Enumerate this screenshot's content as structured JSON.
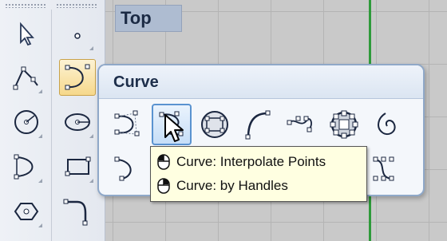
{
  "viewport": {
    "title": "Top"
  },
  "flyout": {
    "title": "Curve"
  },
  "tooltip": {
    "lines": [
      {
        "action": "left-click",
        "text": "Curve: Interpolate Points"
      },
      {
        "action": "right-click",
        "text": "Curve: by Handles"
      }
    ]
  },
  "colors": {
    "viewport_grid": "#c9c9c9",
    "green_axis": "#2e9a3a",
    "tooltip_bg": "#ffffe1",
    "hover_border": "#5a93d0"
  },
  "toolbar": {
    "buttons": [
      {
        "icon": "select-arrow-icon"
      },
      {
        "icon": "point-icon"
      },
      {
        "icon": "polyline-icon"
      },
      {
        "icon": "curve-icon",
        "active": true
      },
      {
        "icon": "circle-icon"
      },
      {
        "icon": "ellipse-icon"
      },
      {
        "icon": "arc-icon"
      },
      {
        "icon": "rectangle-icon"
      },
      {
        "icon": "polygon-icon"
      },
      {
        "icon": "fillet-curve-icon"
      }
    ]
  },
  "flyout_buttons": [
    "control-point-curve-icon",
    "interpolate-points-icon",
    "curve-on-mesh-icon",
    "arc-curve-icon",
    "sketch-curve-icon",
    "circle-points-icon",
    "helix-icon",
    "blend-curve-icon",
    "handle-curve-icon"
  ]
}
